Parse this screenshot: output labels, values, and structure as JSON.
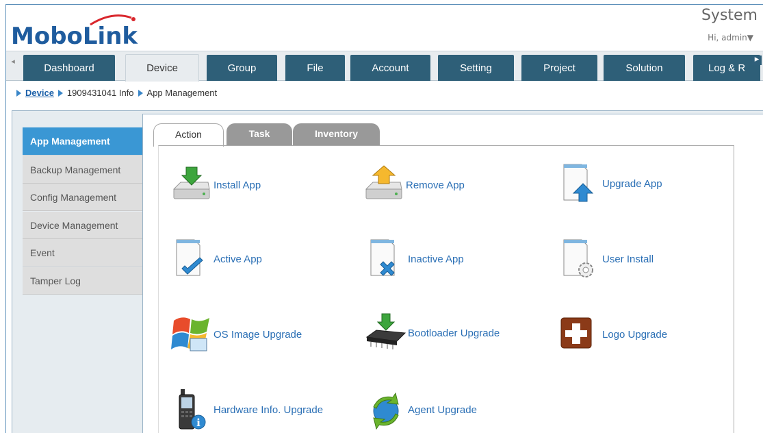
{
  "header": {
    "logo_text": "MoboLink",
    "system_title": "System",
    "greeting": "Hi, admin▼"
  },
  "nav": {
    "tabs": [
      {
        "label": "Dashboard"
      },
      {
        "label": "Device"
      },
      {
        "label": "Group"
      },
      {
        "label": "File"
      },
      {
        "label": "Account"
      },
      {
        "label": "Setting"
      },
      {
        "label": "Project"
      },
      {
        "label": "Solution"
      },
      {
        "label": "Log & R"
      }
    ],
    "active_tab": "Device"
  },
  "breadcrumb": {
    "items": [
      "Device",
      "1909431041 Info",
      "App Management"
    ]
  },
  "sidebar": {
    "items": [
      {
        "label": "App Management"
      },
      {
        "label": "Backup Management"
      },
      {
        "label": "Config Management"
      },
      {
        "label": "Device Management"
      },
      {
        "label": "Event"
      },
      {
        "label": "Tamper Log"
      }
    ],
    "active_item": "App Management"
  },
  "subtabs": {
    "items": [
      {
        "label": "Action"
      },
      {
        "label": "Task"
      },
      {
        "label": "Inventory"
      }
    ],
    "active": "Action"
  },
  "actions": [
    {
      "label": "Install App",
      "icon": "install-drive-icon"
    },
    {
      "label": "Remove App",
      "icon": "remove-drive-icon"
    },
    {
      "label": "Upgrade App",
      "icon": "upgrade-doc-icon"
    },
    {
      "label": "Active App",
      "icon": "active-doc-icon"
    },
    {
      "label": "Inactive App",
      "icon": "inactive-doc-icon"
    },
    {
      "label": "User Install",
      "icon": "user-install-doc-icon"
    },
    {
      "label": "OS Image Upgrade",
      "icon": "os-image-icon"
    },
    {
      "label": "Bootloader Upgrade",
      "icon": "bootloader-chip-icon"
    },
    {
      "label": "Logo Upgrade",
      "icon": "logo-plus-icon"
    },
    {
      "label": "Hardware Info. Upgrade",
      "icon": "hardware-info-icon"
    },
    {
      "label": "Agent Upgrade",
      "icon": "agent-refresh-icon"
    }
  ],
  "colors": {
    "tab_bg": "#2e5f78",
    "accent_blue": "#3a97d4",
    "link_blue": "#2a6fb5",
    "logo_blue": "#1f5c9e",
    "logo_red": "#d9262c"
  }
}
